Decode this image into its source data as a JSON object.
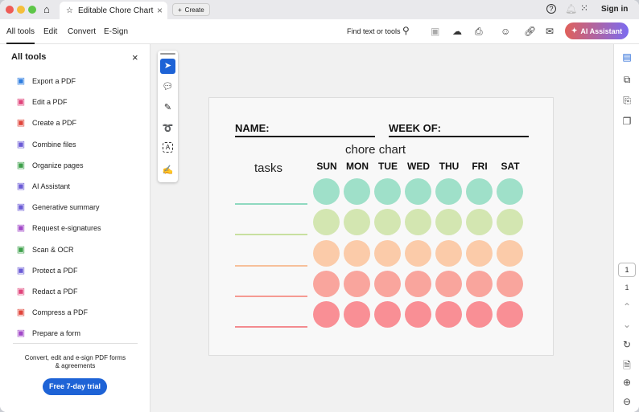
{
  "window": {
    "tab_title": "Editable Chore Chart",
    "create_label": "Create",
    "sign_in": "Sign in"
  },
  "toolbar": {
    "tabs": [
      "All tools",
      "Edit",
      "Convert",
      "E-Sign"
    ],
    "find": "Find text or tools",
    "ai_assistant": "AI Assistant"
  },
  "sidebar": {
    "title": "All tools",
    "items": [
      {
        "label": "Export a PDF",
        "icon": "export-pdf-icon",
        "color": "#2f7ee0"
      },
      {
        "label": "Edit a PDF",
        "icon": "edit-pdf-icon",
        "color": "#e0457b"
      },
      {
        "label": "Create a PDF",
        "icon": "create-pdf-icon",
        "color": "#e0453b"
      },
      {
        "label": "Combine files",
        "icon": "combine-files-icon",
        "color": "#6b5bd6"
      },
      {
        "label": "Organize pages",
        "icon": "organize-pages-icon",
        "color": "#3da04a"
      },
      {
        "label": "AI Assistant",
        "icon": "ai-assistant-icon",
        "color": "#6b5bd6"
      },
      {
        "label": "Generative summary",
        "icon": "summary-icon",
        "color": "#6b5bd6"
      },
      {
        "label": "Request e-signatures",
        "icon": "e-signature-icon",
        "color": "#a248c8"
      },
      {
        "label": "Scan & OCR",
        "icon": "scan-ocr-icon",
        "color": "#3da04a"
      },
      {
        "label": "Protect a PDF",
        "icon": "protect-pdf-icon",
        "color": "#6b5bd6"
      },
      {
        "label": "Redact a PDF",
        "icon": "redact-pdf-icon",
        "color": "#e0457b"
      },
      {
        "label": "Compress a PDF",
        "icon": "compress-pdf-icon",
        "color": "#e0453b"
      },
      {
        "label": "Prepare a form",
        "icon": "prepare-form-icon",
        "color": "#a248c8"
      }
    ],
    "promo": "Convert, edit and e-sign PDF forms & agreements",
    "trial": "Free 7-day trial"
  },
  "document": {
    "name_label": "NAME:",
    "week_label": "WEEK OF:",
    "title": "chore chart",
    "tasks_label": "tasks",
    "days": [
      "SUN",
      "MON",
      "TUE",
      "WED",
      "THU",
      "FRI",
      "SAT"
    ],
    "row_colors": [
      "#9fe0c9",
      "#d3e6b1",
      "#fbcba9",
      "#f9a59d",
      "#f98f95"
    ],
    "line_colors": [
      "#8fd9c0",
      "#c8e0a0",
      "#f7c09a",
      "#f59a92",
      "#f38a8f"
    ]
  },
  "page_nav": {
    "current": "1",
    "total": "1"
  }
}
